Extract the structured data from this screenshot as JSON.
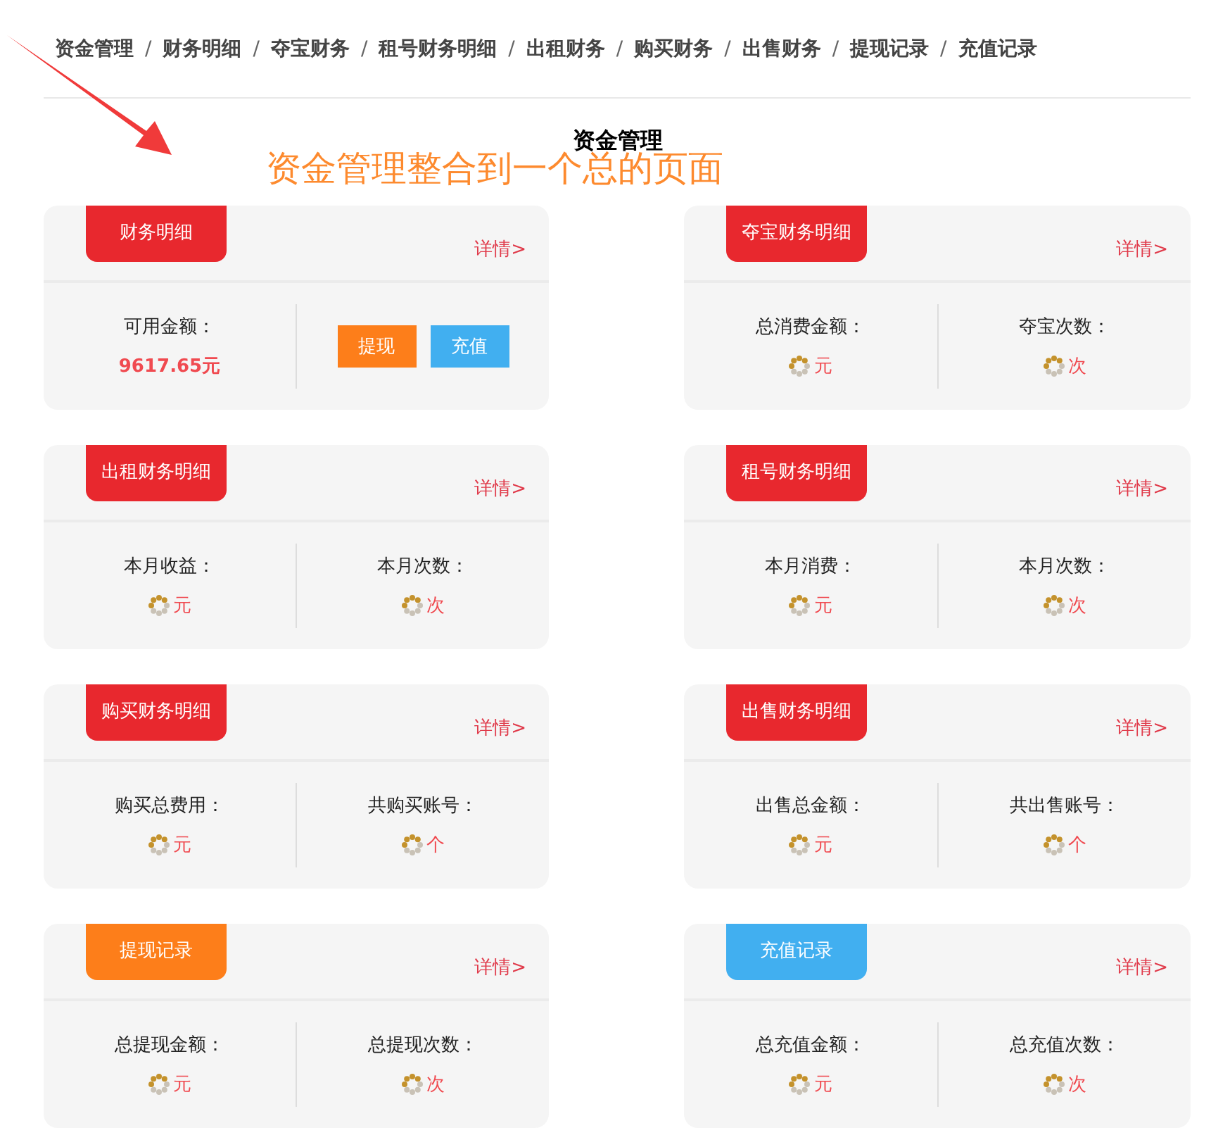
{
  "breadcrumb": [
    "资金管理",
    "财务明细",
    "夺宝财务",
    "租号财务明细",
    "出租财务",
    "购买财务",
    "出售财务",
    "提现记录",
    "充值记录"
  ],
  "separator": "/",
  "title": "资金管理",
  "annotation": "资金管理整合到一个总的页面",
  "cards": [
    {
      "kind": "balance",
      "tab": "财务明细",
      "color": "#e8282e",
      "detail": "详情>",
      "label": "可用金额：",
      "value": "9617.65元",
      "buttons": [
        {
          "label": "提现",
          "color": "#fd7e1a"
        },
        {
          "label": "充值",
          "color": "#41aff0"
        }
      ]
    },
    {
      "kind": "stats",
      "tab": "夺宝财务明细",
      "color": "#e8282e",
      "detail": "详情>",
      "stats": [
        {
          "label": "总消费金额：",
          "unit": "元"
        },
        {
          "label": "夺宝次数：",
          "unit": "次"
        }
      ]
    },
    {
      "kind": "stats",
      "tab": "出租财务明细",
      "color": "#e8282e",
      "detail": "详情>",
      "stats": [
        {
          "label": "本月收益：",
          "unit": "元"
        },
        {
          "label": "本月次数：",
          "unit": "次"
        }
      ]
    },
    {
      "kind": "stats",
      "tab": "租号财务明细",
      "color": "#e8282e",
      "detail": "详情>",
      "stats": [
        {
          "label": "本月消费：",
          "unit": "元"
        },
        {
          "label": "本月次数：",
          "unit": "次"
        }
      ]
    },
    {
      "kind": "stats",
      "tab": "购买财务明细",
      "color": "#e8282e",
      "detail": "详情>",
      "stats": [
        {
          "label": "购买总费用：",
          "unit": "元"
        },
        {
          "label": "共购买账号：",
          "unit": "个"
        }
      ]
    },
    {
      "kind": "stats",
      "tab": "出售财务明细",
      "color": "#e8282e",
      "detail": "详情>",
      "stats": [
        {
          "label": "出售总金额：",
          "unit": "元"
        },
        {
          "label": "共出售账号：",
          "unit": "个"
        }
      ]
    },
    {
      "kind": "stats",
      "tab": "提现记录",
      "color": "#fd7e1a",
      "detail": "详情>",
      "stats": [
        {
          "label": "总提现金额：",
          "unit": "元"
        },
        {
          "label": "总提现次数：",
          "unit": "次"
        }
      ]
    },
    {
      "kind": "stats",
      "tab": "充值记录",
      "color": "#41aff0",
      "detail": "详情>",
      "stats": [
        {
          "label": "总充值金额：",
          "unit": "元"
        },
        {
          "label": "总充值次数：",
          "unit": "次"
        }
      ]
    }
  ]
}
